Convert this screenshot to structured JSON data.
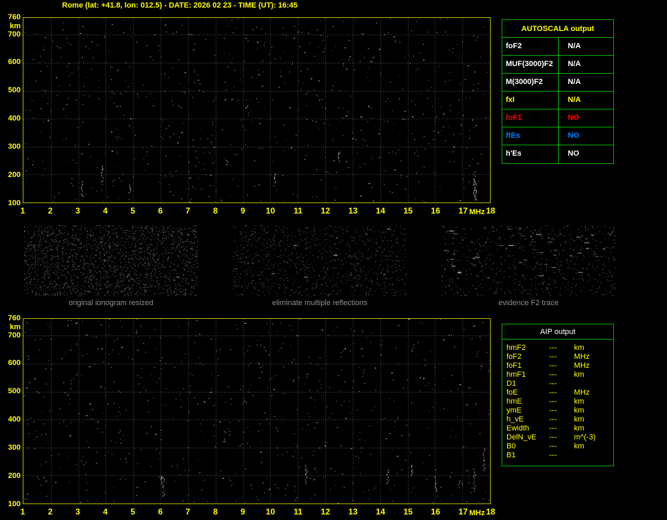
{
  "header": {
    "title": "Rome (lat: +41.8, lon: 012.5) - DATE: 2026 02 23 - TIME (UT): 16:45"
  },
  "colors": {
    "accent_yellow": "#ffff00",
    "table_border_green": "#00b000",
    "caption_gray": "#8f8f8f",
    "plot_border_yellow": "#b9b900"
  },
  "top_ionogram": {
    "y_unit": "km",
    "y_ticks": [
      "760",
      "700",
      "600",
      "500",
      "400",
      "300",
      "200",
      "100"
    ],
    "x_ticks": [
      "1",
      "2",
      "3",
      "4",
      "5",
      "6",
      "7",
      "8",
      "9",
      "10",
      "11",
      "12",
      "13",
      "14",
      "15",
      "16",
      "17",
      "18"
    ],
    "x_unit": "MHz"
  },
  "bottom_ionogram": {
    "y_unit": "km",
    "y_ticks": [
      "760",
      "700",
      "600",
      "500",
      "400",
      "300",
      "200",
      "100"
    ],
    "x_ticks": [
      "1",
      "2",
      "3",
      "4",
      "5",
      "6",
      "7",
      "8",
      "9",
      "10",
      "11",
      "12",
      "13",
      "14",
      "15",
      "16",
      "17",
      "18"
    ],
    "x_unit": "MHz"
  },
  "panels": [
    {
      "label": "original ionogram resized"
    },
    {
      "label": "eliminate multiple reflections"
    },
    {
      "label": "evidence F2 trace"
    }
  ],
  "autoscala_table": {
    "title": "AUTOSCALA output",
    "rows": [
      {
        "param": "foF2",
        "value": "N/A",
        "color": "#ffffff"
      },
      {
        "param": "MUF(3000)F2",
        "value": "N/A",
        "color": "#ffffff"
      },
      {
        "param": "M(3000)F2",
        "value": "N/A",
        "color": "#ffffff"
      },
      {
        "param": "fxI",
        "value": "N/A",
        "color": "#ffff00"
      },
      {
        "param": "foF1",
        "value": "NO",
        "color": "#ff0000"
      },
      {
        "param": "ftEs",
        "value": "NO",
        "color": "#0080ff"
      },
      {
        "param": "h'Es",
        "value": "NO",
        "color": "#ffffff"
      }
    ]
  },
  "aip_table": {
    "title": "AIP output",
    "rows": [
      {
        "param": "hmF2",
        "value": "---",
        "unit": "km"
      },
      {
        "param": "foF2",
        "value": "---",
        "unit": "MHz"
      },
      {
        "param": "foF1",
        "value": "---",
        "unit": "MHz"
      },
      {
        "param": "hmF1",
        "value": "---",
        "unit": "km"
      },
      {
        "param": "D1",
        "value": "---",
        "unit": ""
      },
      {
        "param": "foE",
        "value": "---",
        "unit": "MHz"
      },
      {
        "param": "hmE",
        "value": "---",
        "unit": "km"
      },
      {
        "param": "ymE",
        "value": "---",
        "unit": "km"
      },
      {
        "param": "h_vE",
        "value": "---",
        "unit": "km"
      },
      {
        "param": "Ewidth",
        "value": "---",
        "unit": "km"
      },
      {
        "param": "DelN_vE",
        "value": "---",
        "unit": "m^(-3)"
      },
      {
        "param": "B0",
        "value": "---",
        "unit": "km"
      },
      {
        "param": "B1",
        "value": "---",
        "unit": ""
      }
    ]
  }
}
